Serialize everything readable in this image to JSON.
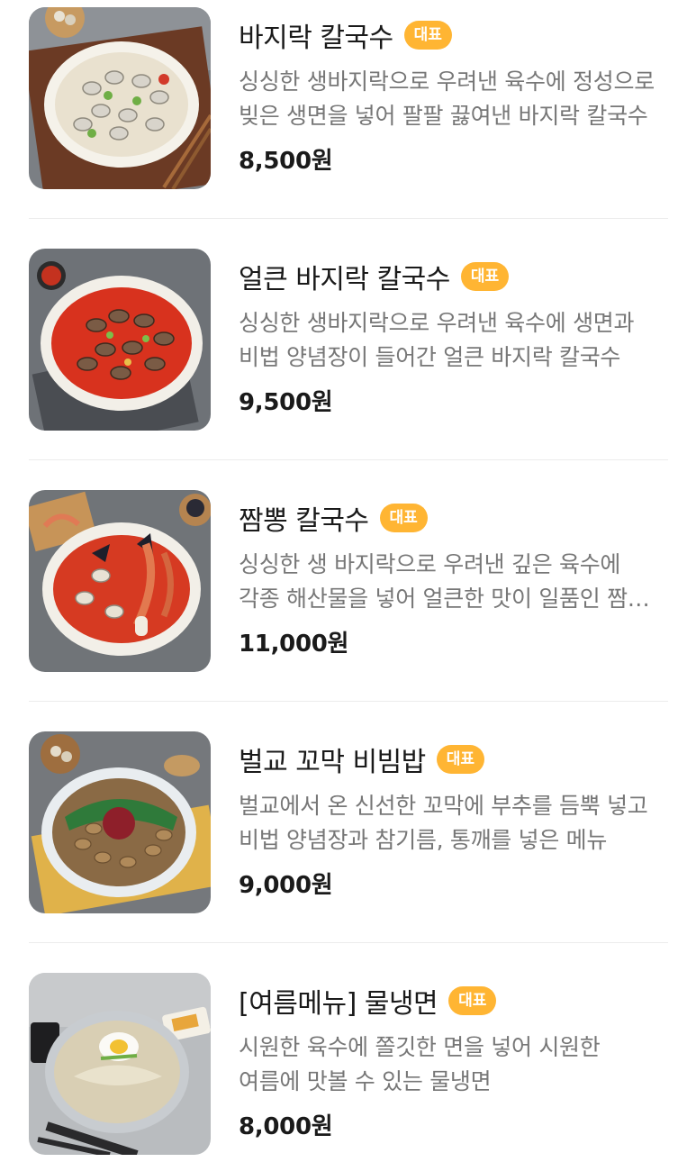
{
  "menu": {
    "items": [
      {
        "name": "바지락 칼국수",
        "badge": "대표",
        "description": "싱싱한 생바지락으로 우려낸 육수에 정성으로 빚은 생면을 넣어 팔팔 끓여낸 바지락 칼국수",
        "price": "8,500원",
        "image_icon": "clam-kalguksu-photo",
        "broth_color": "#e9e1cf"
      },
      {
        "name": "얼큰 바지락 칼국수",
        "badge": "대표",
        "description": "싱싱한 생바지락으로 우려낸 육수에 생면과 비법 양념장이 들어간 얼큰 바지락 칼국수",
        "price": "9,500원",
        "image_icon": "spicy-clam-kalguksu-photo",
        "broth_color": "#d8321e"
      },
      {
        "name": "짬뽕 칼국수",
        "badge": "대표",
        "description": "싱싱한 생 바지락으로 우려낸 깊은 육수에 각종 해산물을 넣어 얼큰한 맛이 일품인 짬뽕 칼국수",
        "price": "11,000원",
        "image_icon": "jjamppong-kalguksu-photo",
        "broth_color": "#d63a22"
      },
      {
        "name": "벌교 꼬막 비빔밥",
        "badge": "대표",
        "description": "벌교에서 온 신선한 꼬막에 부추를 듬뿍 넣고 비법 양념장과 참기름, 통깨를 넣은 메뉴",
        "price": "9,000원",
        "image_icon": "cockle-bibimbap-photo",
        "broth_color": "#8a6a45"
      },
      {
        "name": "[여름메뉴] 물냉면",
        "badge": "대표",
        "description": "시원한 육수에 쫄깃한 면을 넣어 시원한 여름에 맛볼 수 있는 물냉면",
        "price": "8,000원",
        "image_icon": "naengmyeon-photo",
        "broth_color": "#d9cfb4"
      }
    ]
  },
  "colors": {
    "badge": "#ffb533",
    "description": "#777777",
    "divider": "#ececec"
  }
}
